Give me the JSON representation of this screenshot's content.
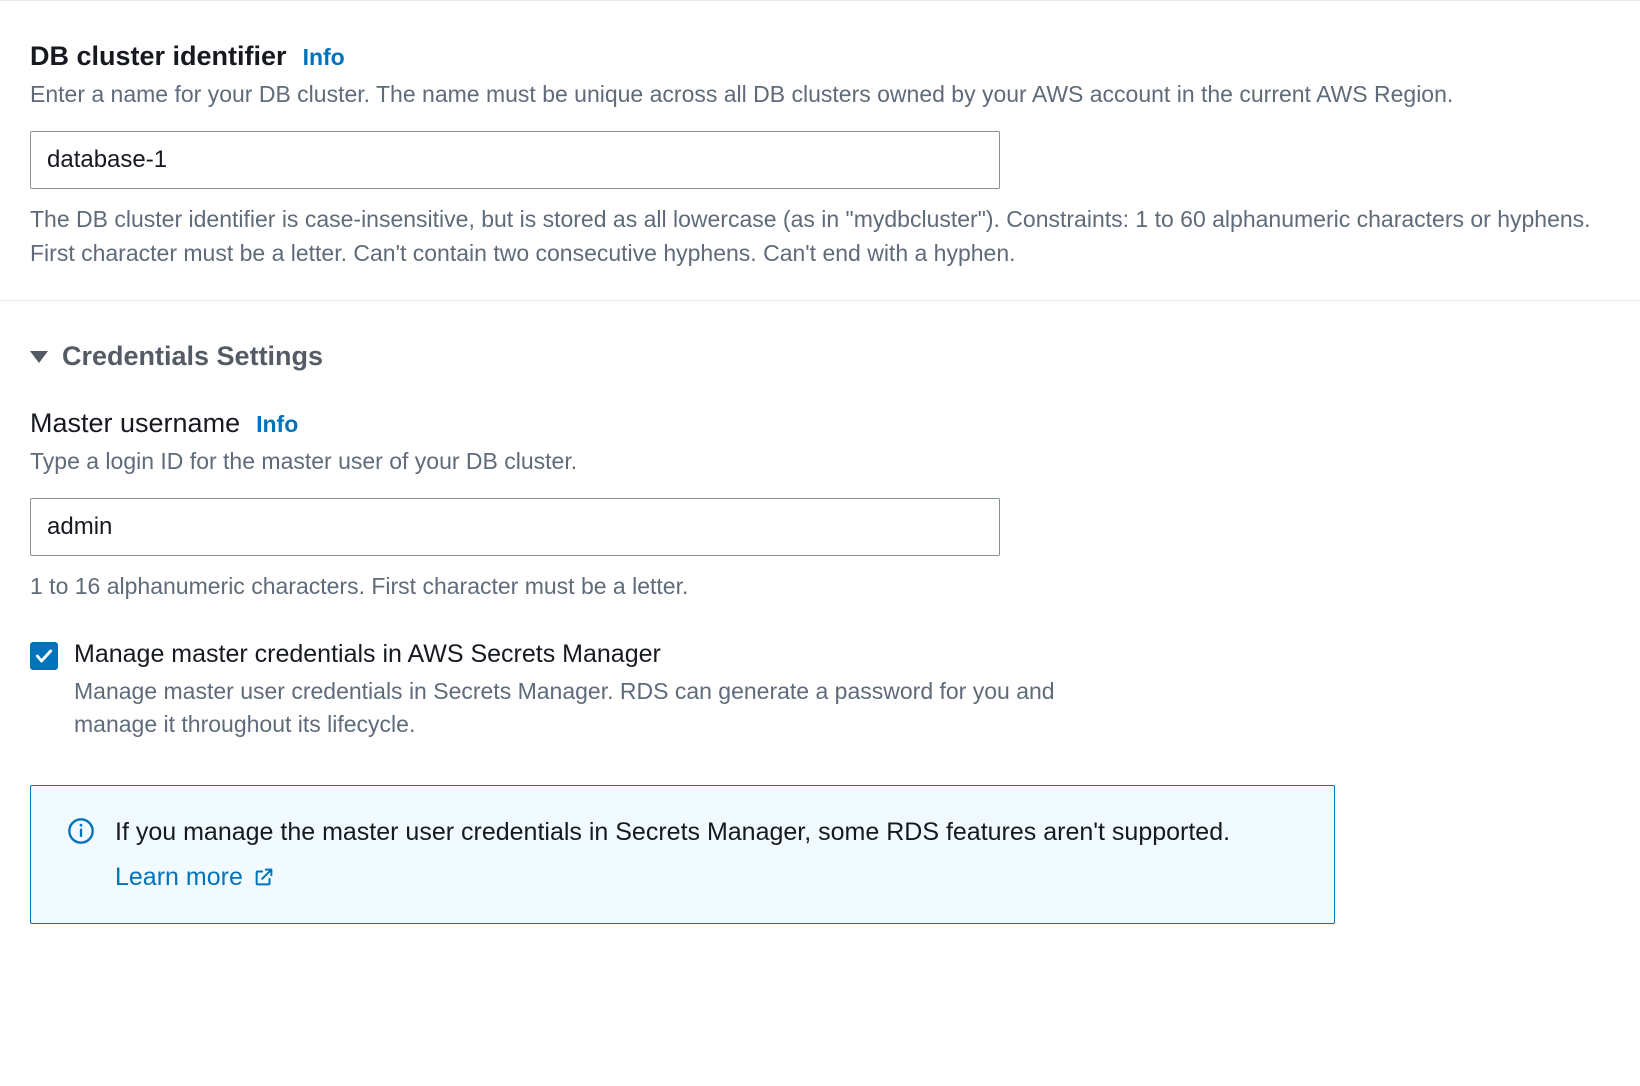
{
  "cluster_id": {
    "label": "DB cluster identifier",
    "info": "Info",
    "description": "Enter a name for your DB cluster. The name must be unique across all DB clusters owned by your AWS account in the current AWS Region.",
    "value": "database-1",
    "constraint": "The DB cluster identifier is case-insensitive, but is stored as all lowercase (as in \"mydbcluster\"). Constraints: 1 to 60 alphanumeric characters or hyphens. First character must be a letter. Can't contain two consecutive hyphens. Can't end with a hyphen."
  },
  "credentials": {
    "section_title": "Credentials Settings",
    "username": {
      "label": "Master username",
      "info": "Info",
      "description": "Type a login ID for the master user of your DB cluster.",
      "value": "admin",
      "constraint": "1 to 16 alphanumeric characters. First character must be a letter."
    },
    "secrets_manager": {
      "checked": true,
      "label": "Manage master credentials in AWS Secrets Manager",
      "description": "Manage master user credentials in Secrets Manager. RDS can generate a password for you and manage it throughout its lifecycle."
    },
    "alert": {
      "message": "If you manage the master user credentials in Secrets Manager, some RDS features aren't supported.",
      "learn_more": "Learn more"
    }
  }
}
